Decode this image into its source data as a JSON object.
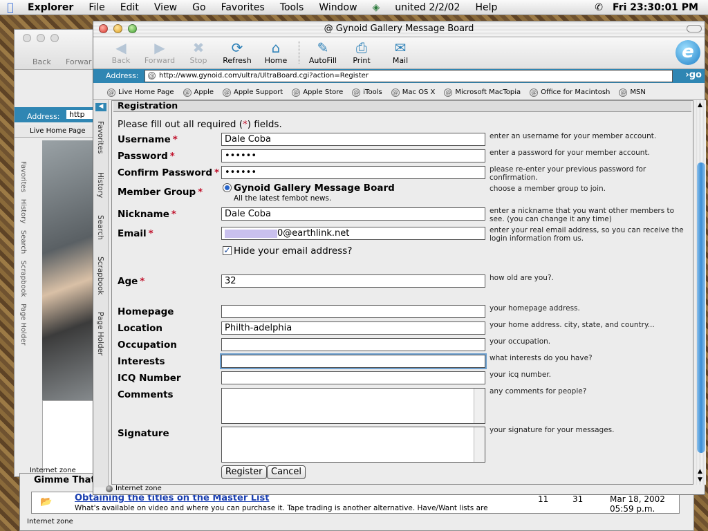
{
  "menubar": {
    "items": [
      "Explorer",
      "File",
      "Edit",
      "View",
      "Go",
      "Favorites",
      "Tools",
      "Window",
      "united 2/2/02",
      "Help"
    ],
    "clock": "Fri 23:30:01 PM"
  },
  "back_window": {
    "back_label": "Back",
    "forward_label": "Forwar",
    "address_label": "Address:",
    "address_value": "http",
    "fav_item": "Live Home Page",
    "status": "Internet zone",
    "side_tabs": [
      "Favorites",
      "History",
      "Search",
      "Scrapbook",
      "Page Holder"
    ]
  },
  "bottom_window": {
    "header": "Gimme That",
    "thread_title": "Obtaining the titles on the Master List",
    "thread_desc": "What's available on video and where you can purchase it. Tape trading is another alternative. Have/Want lists are",
    "col1": "11",
    "col2": "31",
    "date": "Mar 18, 2002",
    "time": "05:59 p.m.",
    "status": "Internet zone"
  },
  "window": {
    "title": "Gynoid Gallery Message Board",
    "toolbar": [
      {
        "label": "Back",
        "icon": "back-arrow-icon",
        "enabled": false
      },
      {
        "label": "Forward",
        "icon": "forward-arrow-icon",
        "enabled": false
      },
      {
        "label": "Stop",
        "icon": "stop-icon",
        "enabled": false
      },
      {
        "label": "Refresh",
        "icon": "refresh-icon",
        "enabled": true
      },
      {
        "label": "Home",
        "icon": "home-icon",
        "enabled": true
      },
      {
        "label": "AutoFill",
        "icon": "autofill-icon",
        "enabled": true
      },
      {
        "label": "Print",
        "icon": "print-icon",
        "enabled": true
      },
      {
        "label": "Mail",
        "icon": "mail-icon",
        "enabled": true
      }
    ],
    "address_label": "Address:",
    "address": "http://www.gynoid.com/ultra/UltraBoard.cgi?action=Register",
    "go_label": "go",
    "favorites": [
      "Live Home Page",
      "Apple",
      "Apple Support",
      "Apple Store",
      "iTools",
      "Mac OS X",
      "Microsoft MacTopia",
      "Office for Macintosh",
      "MSN"
    ],
    "side_tabs": [
      "Favorites",
      "History",
      "Search",
      "Scrapbook",
      "Page Holder"
    ],
    "status": "Internet zone"
  },
  "form": {
    "header": "Registration",
    "intro_pre": "Please fill out all required (",
    "intro_star": "*",
    "intro_post": ") fields.",
    "required_mark": "*",
    "username": {
      "label": "Username",
      "value": "Dale Coba",
      "hint": "enter an username for your member account."
    },
    "password": {
      "label": "Password",
      "value": "••••••",
      "hint": "enter a password for your member account."
    },
    "confirm": {
      "label": "Confirm Password",
      "value": "••••••",
      "hint": "please re-enter your previous password for confirmation."
    },
    "group": {
      "label": "Member Group",
      "option": "Gynoid Gallery Message Board",
      "option_desc": "All the latest fembot news.",
      "hint": "choose a member group to join."
    },
    "nickname": {
      "label": "Nickname",
      "value": "Dale Coba",
      "hint": "enter a nickname that you want other members to see. (you can change it any time)"
    },
    "email": {
      "label": "Email",
      "value_suffix": "0@earthlink.net",
      "hint": "enter your real email address, so you can receive the login information from us."
    },
    "hide_email": {
      "label": "Hide your email address?",
      "checked": true
    },
    "age": {
      "label": "Age",
      "value": "32",
      "hint": "how old are you?."
    },
    "homepage": {
      "label": "Homepage",
      "value": "",
      "hint": "your homepage address."
    },
    "location": {
      "label": "Location",
      "value": "Philth-adelphia",
      "hint": "your home address. city, state, and country..."
    },
    "occupation": {
      "label": "Occupation",
      "value": "",
      "hint": "your occupation."
    },
    "interests": {
      "label": "Interests",
      "value": "",
      "hint": "what interests do you have?"
    },
    "icq": {
      "label": "ICQ Number",
      "value": "",
      "hint": "your icq number."
    },
    "comments": {
      "label": "Comments",
      "hint": "any comments for people?"
    },
    "signature": {
      "label": "Signature",
      "hint": "your signature for your messages."
    },
    "register_label": "Register",
    "cancel_label": "Cancel"
  }
}
